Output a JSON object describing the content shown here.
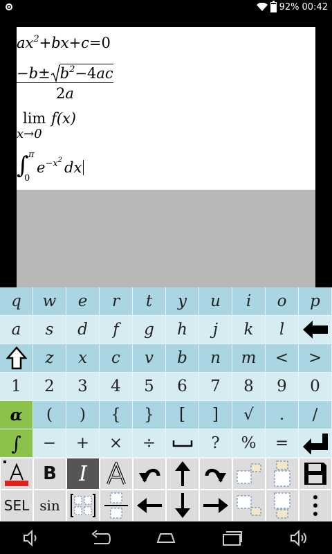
{
  "status_bar": {
    "battery": "92%",
    "time": "00:42",
    "icons": [
      "app-notification-icon",
      "wifi-icon",
      "battery-icon"
    ]
  },
  "document": {
    "eq1": {
      "a": "a",
      "x1": "x",
      "exp": "2",
      "plus1": "+",
      "b": "bx",
      "plus2": "+",
      "c": "c",
      "eq": "=",
      "zero": "0"
    },
    "eq2": {
      "num_neg": "−",
      "num_b": "b",
      "pm": "±",
      "root_b": "b",
      "root_exp": "2",
      "minus": "−",
      "four": "4",
      "ac": "ac",
      "den": "2",
      "den_a": "a"
    },
    "eq3": {
      "lim": "lim",
      "fx": "f(x)",
      "sub": "x→0"
    },
    "eq4": {
      "int": "∫",
      "upper": "π",
      "lower": "0",
      "e": "e",
      "exp": "−x",
      "exp2": "2",
      "dx": "dx"
    }
  },
  "keyboard": {
    "row1": [
      "q",
      "w",
      "e",
      "r",
      "t",
      "y",
      "u",
      "i",
      "o",
      "p"
    ],
    "row2": [
      "a",
      "s",
      "d",
      "f",
      "g",
      "h",
      "j",
      "k",
      "l",
      "⬅"
    ],
    "row3": [
      "⇧",
      "z",
      "x",
      "c",
      "v",
      "b",
      "n",
      "m",
      "<",
      ">"
    ],
    "row4": [
      "1",
      "2",
      "3",
      "4",
      "5",
      "6",
      "7",
      "8",
      "9",
      "0"
    ],
    "row5": [
      "α",
      "(",
      ")",
      "{",
      "}",
      "[",
      "]",
      "√",
      ".",
      "/"
    ],
    "row6": [
      "∫",
      "−",
      "+",
      "×",
      "÷",
      "⎵",
      "?",
      "%",
      "=",
      "⏎"
    ]
  },
  "toolbar": {
    "bold": "B",
    "italic": "I",
    "sel": "SEL",
    "sin": "sin"
  },
  "colors": {
    "key_dark": "#a9d6e2",
    "key_light": "#d7ecf2",
    "key_green": "#8ac24a",
    "toolbar_bg": "#dcdcdc",
    "doc_empty": "#b8b8b8"
  }
}
